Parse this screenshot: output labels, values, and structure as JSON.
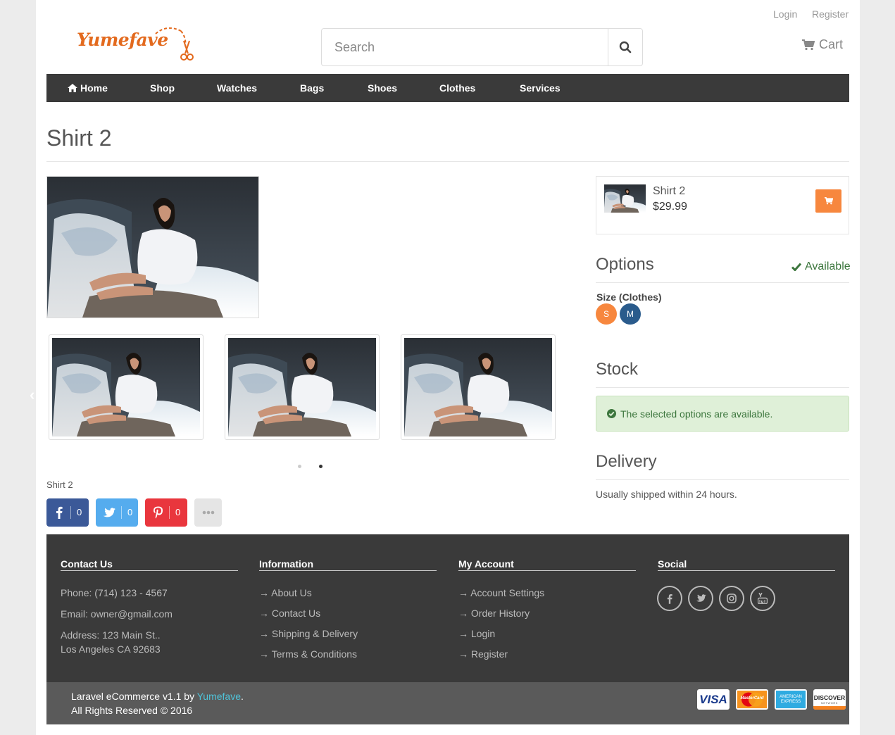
{
  "header": {
    "login": "Login",
    "register": "Register",
    "logo": "Yumefave",
    "search_placeholder": "Search",
    "cart": "Cart"
  },
  "nav": {
    "items": [
      "Home",
      "Shop",
      "Watches",
      "Bags",
      "Shoes",
      "Clothes",
      "Services"
    ]
  },
  "product": {
    "title": "Shirt 2",
    "caption": "Shirt 2",
    "name": "Shirt 2",
    "price": "$29.99",
    "carousel_active_index": 1
  },
  "share": {
    "facebook_count": "0",
    "twitter_count": "0",
    "pinterest_count": "0"
  },
  "options": {
    "heading": "Options",
    "availability": "Available",
    "size_label": "Size (Clothes)",
    "sizes": [
      "S",
      "M"
    ]
  },
  "stock": {
    "heading": "Stock",
    "message": "The selected options are available."
  },
  "delivery": {
    "heading": "Delivery",
    "text": "Usually shipped within 24 hours."
  },
  "footer": {
    "contact": {
      "heading": "Contact Us",
      "phone": "Phone: (714) 123 - 4567",
      "email": "Email: owner@gmail.com",
      "address1": "Address: 123 Main St..",
      "address2": "Los Angeles CA 92683"
    },
    "information": {
      "heading": "Information",
      "links": [
        "About Us",
        "Contact Us",
        "Shipping & Delivery",
        "Terms & Conditions"
      ]
    },
    "account": {
      "heading": "My Account",
      "links": [
        "Account Settings",
        "Order History",
        "Login",
        "Register"
      ]
    },
    "social": {
      "heading": "Social",
      "icons": [
        "facebook-icon",
        "twitter-icon",
        "instagram-icon",
        "youtube-icon"
      ]
    },
    "copyright_prefix": "Laravel eCommerce v1.1 by ",
    "copyright_brand": "Yumefave",
    "copyright_suffix": ".",
    "rights": "All Rights Reserved © 2016",
    "cards": {
      "visa": "VISA",
      "mastercard": "MasterCard",
      "amex_1": "AMERICAN",
      "amex_2": "EXPRESS",
      "discover": "DISCOVER",
      "discover_sub": "NETWORK"
    }
  },
  "colors": {
    "nav_bg": "#3a3a3a",
    "accent_orange": "#f7873e",
    "size_m_blue": "#2a5b8c",
    "success_green": "#3c763d",
    "facebook": "#3b5998",
    "twitter": "#55acee",
    "pinterest": "#e9363d"
  }
}
